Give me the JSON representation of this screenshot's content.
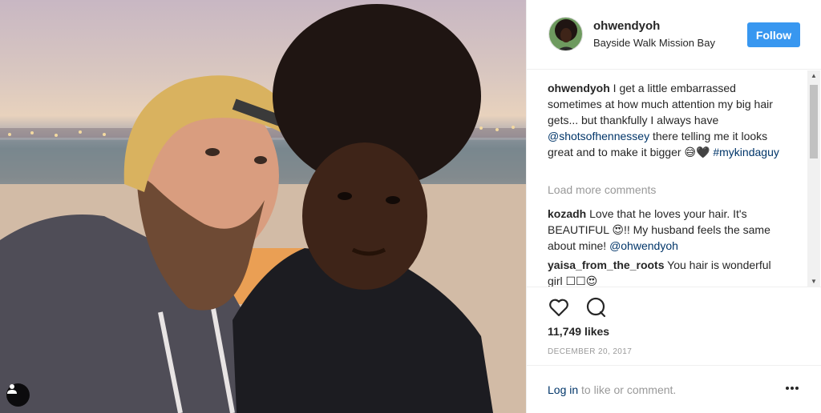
{
  "post": {
    "username": "ohwendyoh",
    "location": "Bayside Walk Mission Bay",
    "follow_label": "Follow"
  },
  "caption": {
    "username": "ohwendyoh",
    "text_1": "I get a little embarrassed sometimes at how much attention my big hair gets... but thankfully I always have",
    "mention": "@shotsofhennessey",
    "text_2": "there telling me it looks great and to make it bigger 😅🖤",
    "hashtag": "#mykindaguy"
  },
  "load_more": "Load more comments",
  "comments": [
    {
      "username": "kozadh",
      "text": "Love that he loves your hair. It's BEAUTIFUL 😍!! My husband feels the same about mine!",
      "mention": "@ohwendyoh"
    },
    {
      "username": "yaisa_from_the_roots",
      "text": "You hair is wonderful girl ☐☐😍"
    }
  ],
  "likes": "11,749 likes",
  "date": "DECEMBER 20, 2017",
  "footer": {
    "login": "Log in",
    "rest": "to like or comment."
  },
  "icons": {
    "like": "heart-icon",
    "comment": "comment-icon",
    "more": "more-options-icon",
    "tagged": "tagged-user-icon"
  },
  "colors": {
    "follow_button": "#3897f0",
    "link": "#003569",
    "muted": "#999999"
  }
}
